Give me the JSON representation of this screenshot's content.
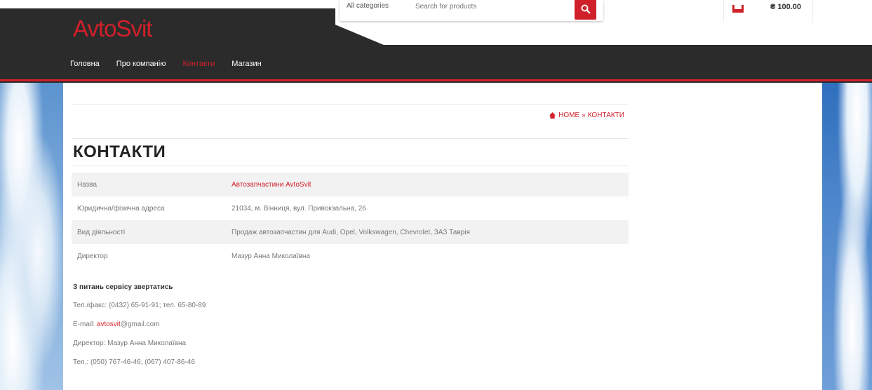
{
  "header": {
    "logo": "AvtoSvit",
    "search": {
      "category": "All categories",
      "placeholder": "Search for products"
    },
    "cart": {
      "total": "₴ 100.00"
    },
    "nav": [
      {
        "label": "Головна",
        "active": false
      },
      {
        "label": "Про компанію",
        "active": false
      },
      {
        "label": "Контакти",
        "active": true
      },
      {
        "label": "Магазин",
        "active": false
      }
    ]
  },
  "breadcrumb": {
    "home": "HOME",
    "separator": "»",
    "current": "КОНТАКТИ"
  },
  "page_title": "КОНТАКТИ",
  "info_table": [
    {
      "label": "Назва",
      "value": "Автозапчастини AvtoSvit"
    },
    {
      "label": "Юридична/фізична адреса",
      "value": "21034, м. Вінниця, вул. Привокзальна, 26"
    },
    {
      "label": "Вид діяльності",
      "value": "Продаж автозапчастин для Audi, Opel, Volkswagen, Chevrolet, ЗАЗ Таврія"
    },
    {
      "label": "Директор",
      "value": "Мазур Анна Миколаївна"
    }
  ],
  "service": {
    "heading": "З питань сервісу звертатись",
    "phone_fax": "Тел./факс: (0432) 65-91-91; тел. 65-80-89",
    "email_prefix": "E-mail: ",
    "email_link": "avtosvit",
    "email_suffix": "@gmail.com",
    "director": "Директор: Мазур Анна Миколаївна",
    "tel": "Тел.: (050) 767-46-46; (067) 407-86-46"
  },
  "colors": {
    "accent": "#d0202a",
    "header_bg": "#2b2b2b"
  }
}
